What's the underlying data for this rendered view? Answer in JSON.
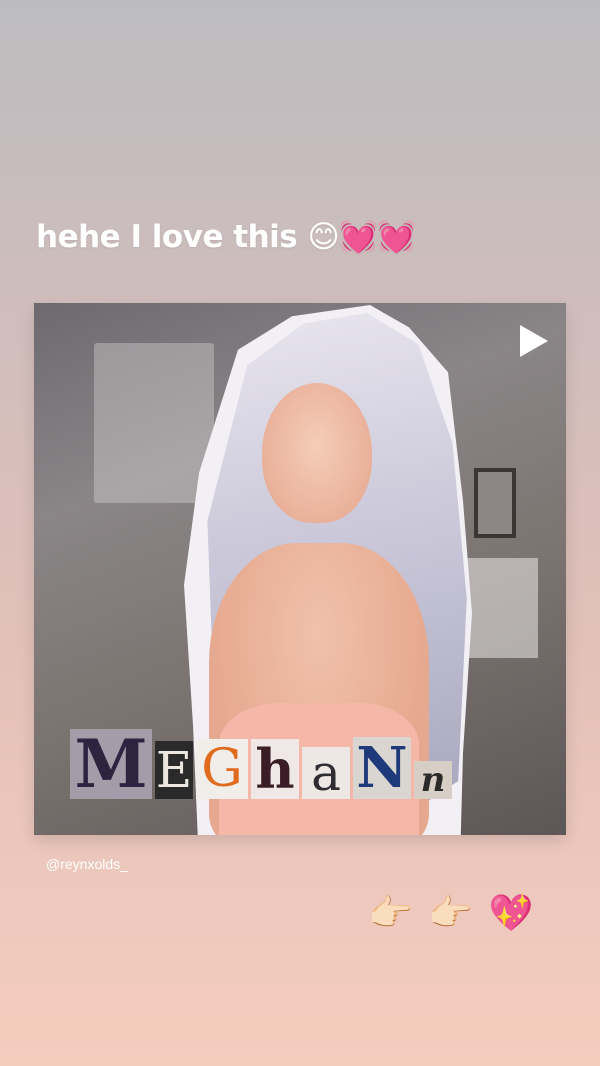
{
  "story": {
    "caption": "hehe I love this 😊💓💓",
    "mention": "@reynxolds_",
    "sticker_emoji": [
      "👉🏻",
      "👉🏻",
      "💖"
    ]
  },
  "post": {
    "play_icon": "play-icon",
    "name_letters": [
      "M",
      "E",
      "G",
      "h",
      "a",
      "N",
      "n"
    ],
    "letter_colors": [
      "#2f2440",
      "#ece7e0",
      "#e06a1d",
      "#3a1d27",
      "#2e2e32",
      "#1f3a7a",
      "#2b2b2b"
    ],
    "letter_backgrounds": [
      "#a69ba8",
      "#2a2a2a",
      "#f1ede8",
      "#efe8e6",
      "#ede8e3",
      "#d9d6d2",
      "#d7cfc5"
    ]
  }
}
